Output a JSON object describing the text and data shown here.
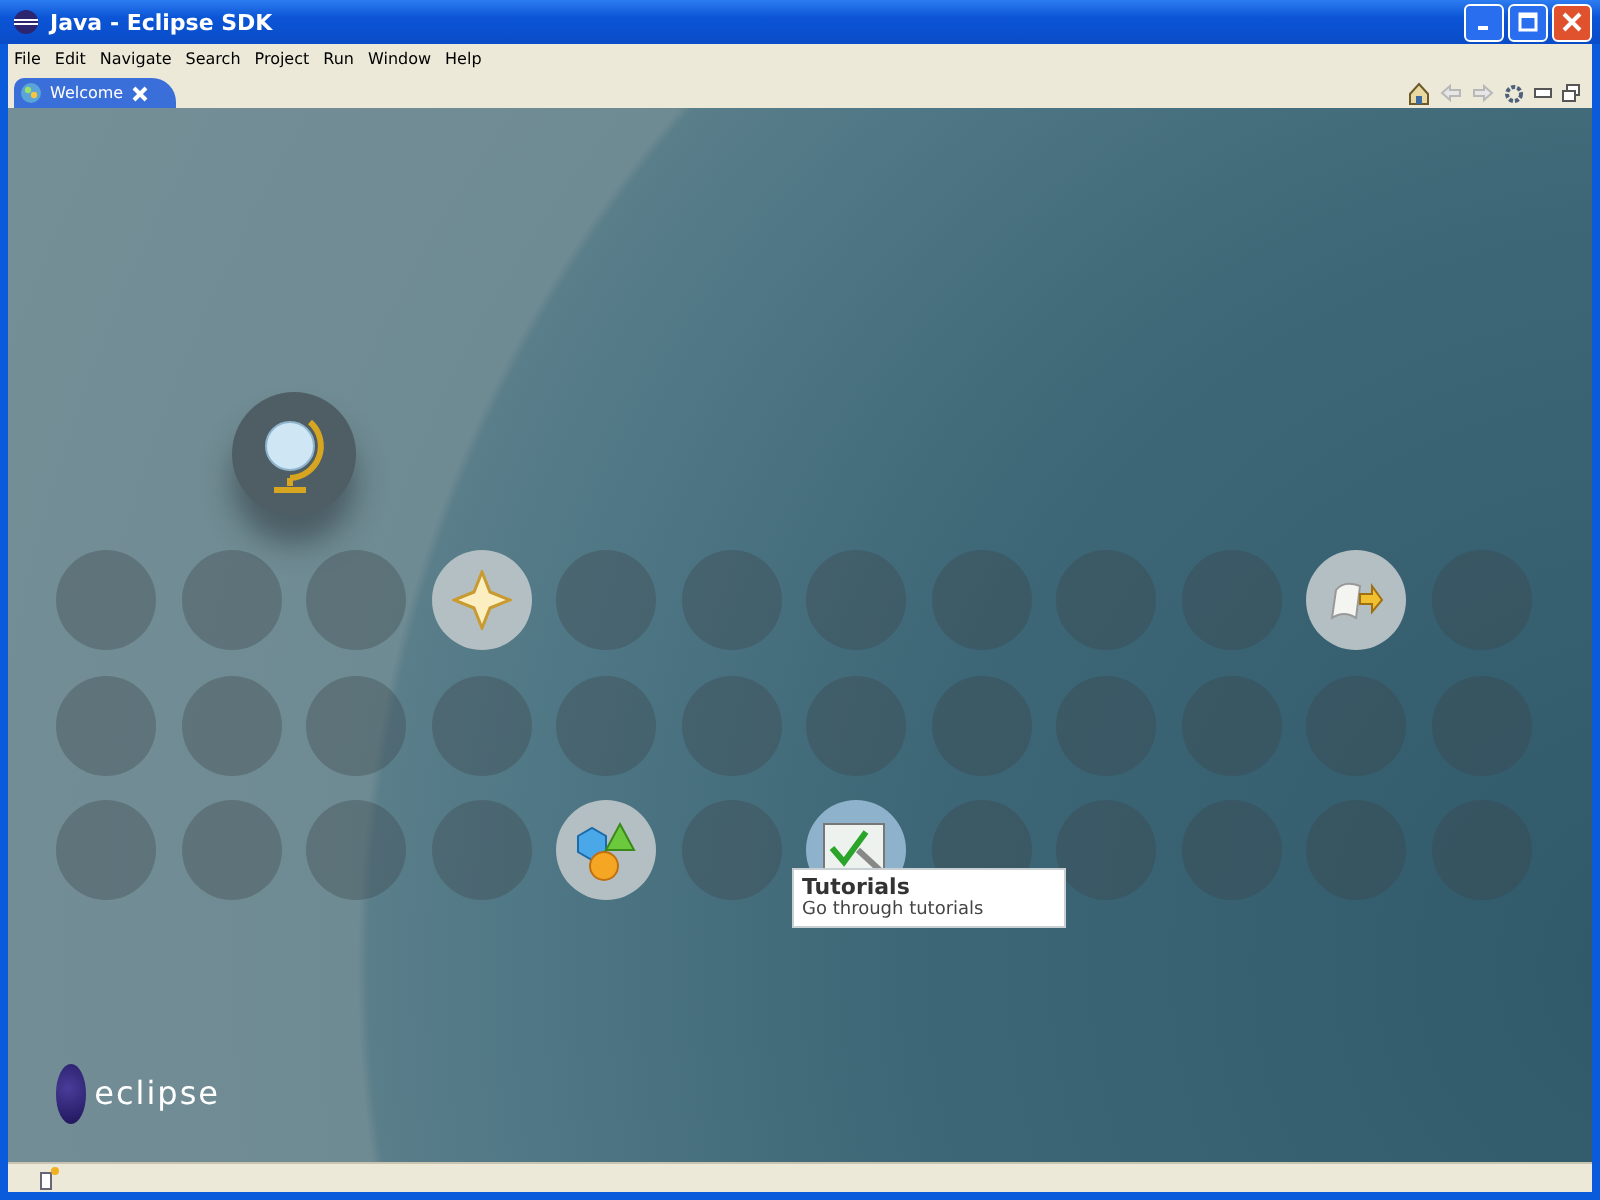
{
  "window": {
    "title": "Java - Eclipse SDK"
  },
  "menu": [
    "File",
    "Edit",
    "Navigate",
    "Search",
    "Project",
    "Run",
    "Window",
    "Help"
  ],
  "tabs": [
    {
      "label": "Welcome",
      "selected": true
    }
  ],
  "welcome": {
    "items": [
      {
        "kind": "overview",
        "selected": false
      },
      {
        "kind": "whats-new",
        "selected": false
      },
      {
        "kind": "migrate",
        "selected": false
      },
      {
        "kind": "samples",
        "selected": false
      },
      {
        "kind": "tutorials",
        "selected": true
      }
    ],
    "tooltip": {
      "title": "Tutorials",
      "description": "Go through tutorials"
    },
    "logo": "eclipse"
  }
}
